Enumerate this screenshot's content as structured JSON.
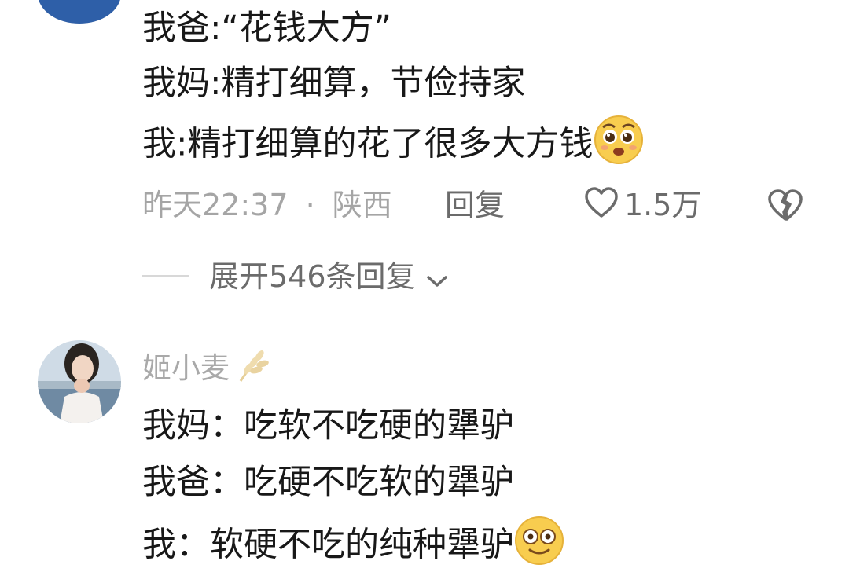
{
  "comment1": {
    "lines": [
      "我爸:“花钱大方”",
      "我妈:精打细算，节俭持家",
      "我:精打细算的花了很多大方钱"
    ],
    "emoji": "pleading-face-emoji",
    "time": "昨天22:37",
    "separator": "·",
    "location": "陕西",
    "reply_label": "回复",
    "likes": "1.5万",
    "expand_label": "展开546条回复"
  },
  "comment2": {
    "username": "姬小麦",
    "badge_icon": "wheat-icon",
    "lines": [
      "我妈：吃软不吃硬的犟驴",
      "我爸：吃硬不吃软的犟驴",
      "我：软硬不吃的纯种犟驴"
    ],
    "emoji": "smiling-face-emoji"
  },
  "colors": {
    "text": "#181818",
    "meta": "#a5a5a5",
    "link": "#6b6b6b",
    "emoji": "#f6c84a"
  }
}
